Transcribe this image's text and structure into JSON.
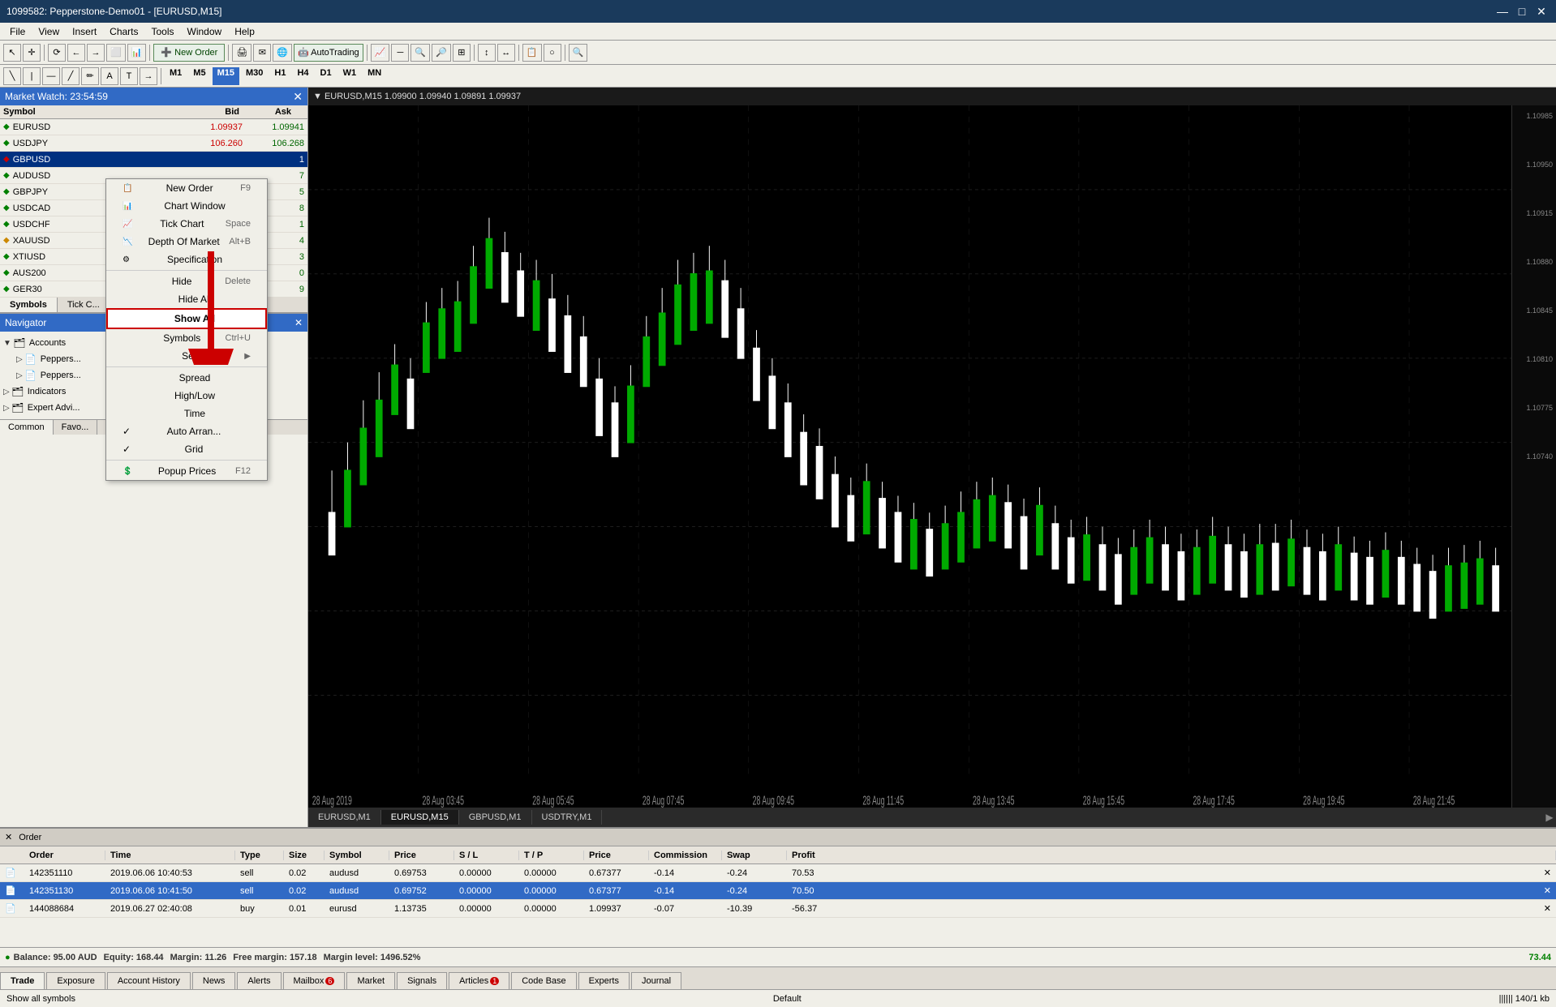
{
  "titleBar": {
    "title": "1099582: Pepperstone-Demo01 - [EURUSD,M15]",
    "minimize": "—",
    "maximize": "□",
    "close": "✕"
  },
  "menuBar": {
    "items": [
      "File",
      "View",
      "Insert",
      "Charts",
      "Tools",
      "Window",
      "Help"
    ]
  },
  "toolbar": {
    "newOrder": "New Order",
    "autoTrading": "AutoTrading",
    "timeframes": [
      "M1",
      "M5",
      "M15",
      "M30",
      "H1",
      "H4",
      "D1",
      "W1",
      "MN"
    ],
    "activeTimeframe": "M15"
  },
  "marketWatch": {
    "header": "Market Watch: 23:54:59",
    "columns": [
      "Symbol",
      "Bid",
      "Ask"
    ],
    "symbols": [
      {
        "name": "EURUSD",
        "bid": "1.09937",
        "ask": "1.09941",
        "selected": false
      },
      {
        "name": "USDJPY",
        "bid": "106.260",
        "ask": "106.268",
        "selected": false
      },
      {
        "name": "GBPUSD",
        "bid": "",
        "ask": "1",
        "selected": true
      },
      {
        "name": "AUDUSD",
        "bid": "",
        "ask": "7",
        "selected": false
      },
      {
        "name": "GBPJPY",
        "bid": "",
        "ask": "5",
        "selected": false
      },
      {
        "name": "USDCAD",
        "bid": "",
        "ask": "8",
        "selected": false
      },
      {
        "name": "USDCHF",
        "bid": "",
        "ask": "1",
        "selected": false
      },
      {
        "name": "XAUUSD",
        "bid": "",
        "ask": "4",
        "selected": false
      },
      {
        "name": "XTIUSD",
        "bid": "",
        "ask": "3",
        "selected": false
      },
      {
        "name": "AUS200",
        "bid": "",
        "ask": "0",
        "selected": false
      },
      {
        "name": "GER30",
        "bid": "",
        "ask": "9",
        "selected": false
      }
    ],
    "tabs": [
      "Symbols",
      "Tick C..."
    ]
  },
  "navigator": {
    "header": "Navigator",
    "items": [
      {
        "label": "Accounts",
        "level": 0,
        "type": "folder"
      },
      {
        "label": "Peppers...",
        "level": 1,
        "type": "account"
      },
      {
        "label": "Peppers...",
        "level": 1,
        "type": "account"
      },
      {
        "label": "Indicators",
        "level": 0,
        "type": "folder"
      },
      {
        "label": "Expert Advi...",
        "level": 0,
        "type": "folder"
      }
    ],
    "tabs": [
      "Common",
      "Favo..."
    ]
  },
  "contextMenu": {
    "items": [
      {
        "label": "New Order",
        "shortcut": "F9",
        "icon": "order",
        "separator": false
      },
      {
        "label": "Chart Window",
        "shortcut": "",
        "icon": "chart",
        "separator": false
      },
      {
        "label": "Tick Chart",
        "shortcut": "Space",
        "icon": "tick",
        "separator": false
      },
      {
        "label": "Depth Of Market",
        "shortcut": "Alt+B",
        "icon": "depth",
        "separator": false
      },
      {
        "label": "Specification",
        "shortcut": "",
        "icon": "spec",
        "separator": true
      },
      {
        "label": "Hide",
        "shortcut": "Delete",
        "icon": "",
        "separator": false
      },
      {
        "label": "Hide All",
        "shortcut": "",
        "icon": "",
        "separator": false
      },
      {
        "label": "Show All",
        "shortcut": "",
        "icon": "",
        "separator": false,
        "highlight": true
      },
      {
        "label": "Symbols",
        "shortcut": "Ctrl+U",
        "icon": "",
        "separator": false
      },
      {
        "label": "Sets",
        "shortcut": "",
        "icon": "",
        "separator": true,
        "hasArrow": true
      },
      {
        "label": "Spread",
        "shortcut": "",
        "icon": "",
        "separator": false
      },
      {
        "label": "High/Low",
        "shortcut": "",
        "icon": "",
        "separator": false
      },
      {
        "label": "Time",
        "shortcut": "",
        "icon": "",
        "separator": false
      },
      {
        "label": "Auto Arran...",
        "shortcut": "",
        "icon": "",
        "separator": false,
        "checked": true
      },
      {
        "label": "Grid",
        "shortcut": "",
        "icon": "",
        "separator": false,
        "checked": true
      },
      {
        "label": "Popup Prices",
        "shortcut": "F12",
        "icon": "popup",
        "separator": false
      }
    ]
  },
  "chart": {
    "header": "▼ EURUSD,M15  1.09900 1.09940 1.09891 1.09937",
    "tabs": [
      "EURUSD,M1",
      "EURUSD,M15",
      "GBPUSD,M1",
      "USDTRY,M1"
    ],
    "activeTab": "EURUSD,M15",
    "priceLabels": [
      "1.10985",
      "1.10950",
      "1.10915",
      "1.10880",
      "1.10845",
      "1.10810",
      "1.10775",
      "1.10740"
    ],
    "timeLabels": [
      "28 Aug 2019",
      "28 Aug 03:45",
      "28 Aug 05:45",
      "28 Aug 07:45",
      "28 Aug 09:45",
      "28 Aug 11:45",
      "28 Aug 13:45",
      "28 Aug 15:45",
      "28 Aug 17:45",
      "28 Aug 19:45",
      "28 Aug 21:45"
    ]
  },
  "orders": {
    "header": "Order",
    "columns": [
      "",
      "Order",
      "Time",
      "Type",
      "Size",
      "Symbol",
      "Price",
      "S / L",
      "T / P",
      "Price",
      "Commission",
      "Swap",
      "Profit"
    ],
    "rows": [
      {
        "icon": "buy",
        "order": "142351110",
        "time": "2019.06.06 10:40:53",
        "type": "sell",
        "size": "0.02",
        "symbol": "audusd",
        "price": "0.69753",
        "sl": "0.00000",
        "tp": "0.00000",
        "cprice": "0.67377",
        "commission": "-0.14",
        "swap": "-0.24",
        "profit": "70.53",
        "selected": false
      },
      {
        "icon": "sell",
        "order": "142351130",
        "time": "2019.06.06 10:41:50",
        "type": "sell",
        "size": "0.02",
        "symbol": "audusd",
        "price": "0.69752",
        "sl": "0.00000",
        "tp": "0.00000",
        "cprice": "0.67377",
        "commission": "-0.14",
        "swap": "-0.24",
        "profit": "70.50",
        "selected": true
      },
      {
        "icon": "buy",
        "order": "144088684",
        "time": "2019.06.27 02:40:08",
        "type": "buy",
        "size": "0.01",
        "symbol": "eurusd",
        "price": "1.13735",
        "sl": "0.00000",
        "tp": "0.00000",
        "cprice": "1.09937",
        "commission": "-0.07",
        "swap": "-10.39",
        "profit": "-56.37",
        "selected": false
      }
    ]
  },
  "statusBar": {
    "balance": "Balance: 95.00 AUD",
    "equity": "Equity: 168.44",
    "margin": "Margin: 11.26",
    "freeMargin": "Free margin: 157.18",
    "marginLevel": "Margin level: 1496.52%",
    "total": "73.44"
  },
  "bottomTabs": {
    "tabs": [
      "Trade",
      "Exposure",
      "Account History",
      "News",
      "Alerts",
      "Mailbox",
      "Market",
      "Signals",
      "Articles",
      "Code Base",
      "Experts",
      "Journal"
    ],
    "active": "Trade",
    "badges": {
      "Mailbox": "6",
      "Articles": "1"
    }
  },
  "footer": {
    "left": "Show all symbols",
    "center": "Default",
    "right": "|||||| 140/1 kb"
  }
}
